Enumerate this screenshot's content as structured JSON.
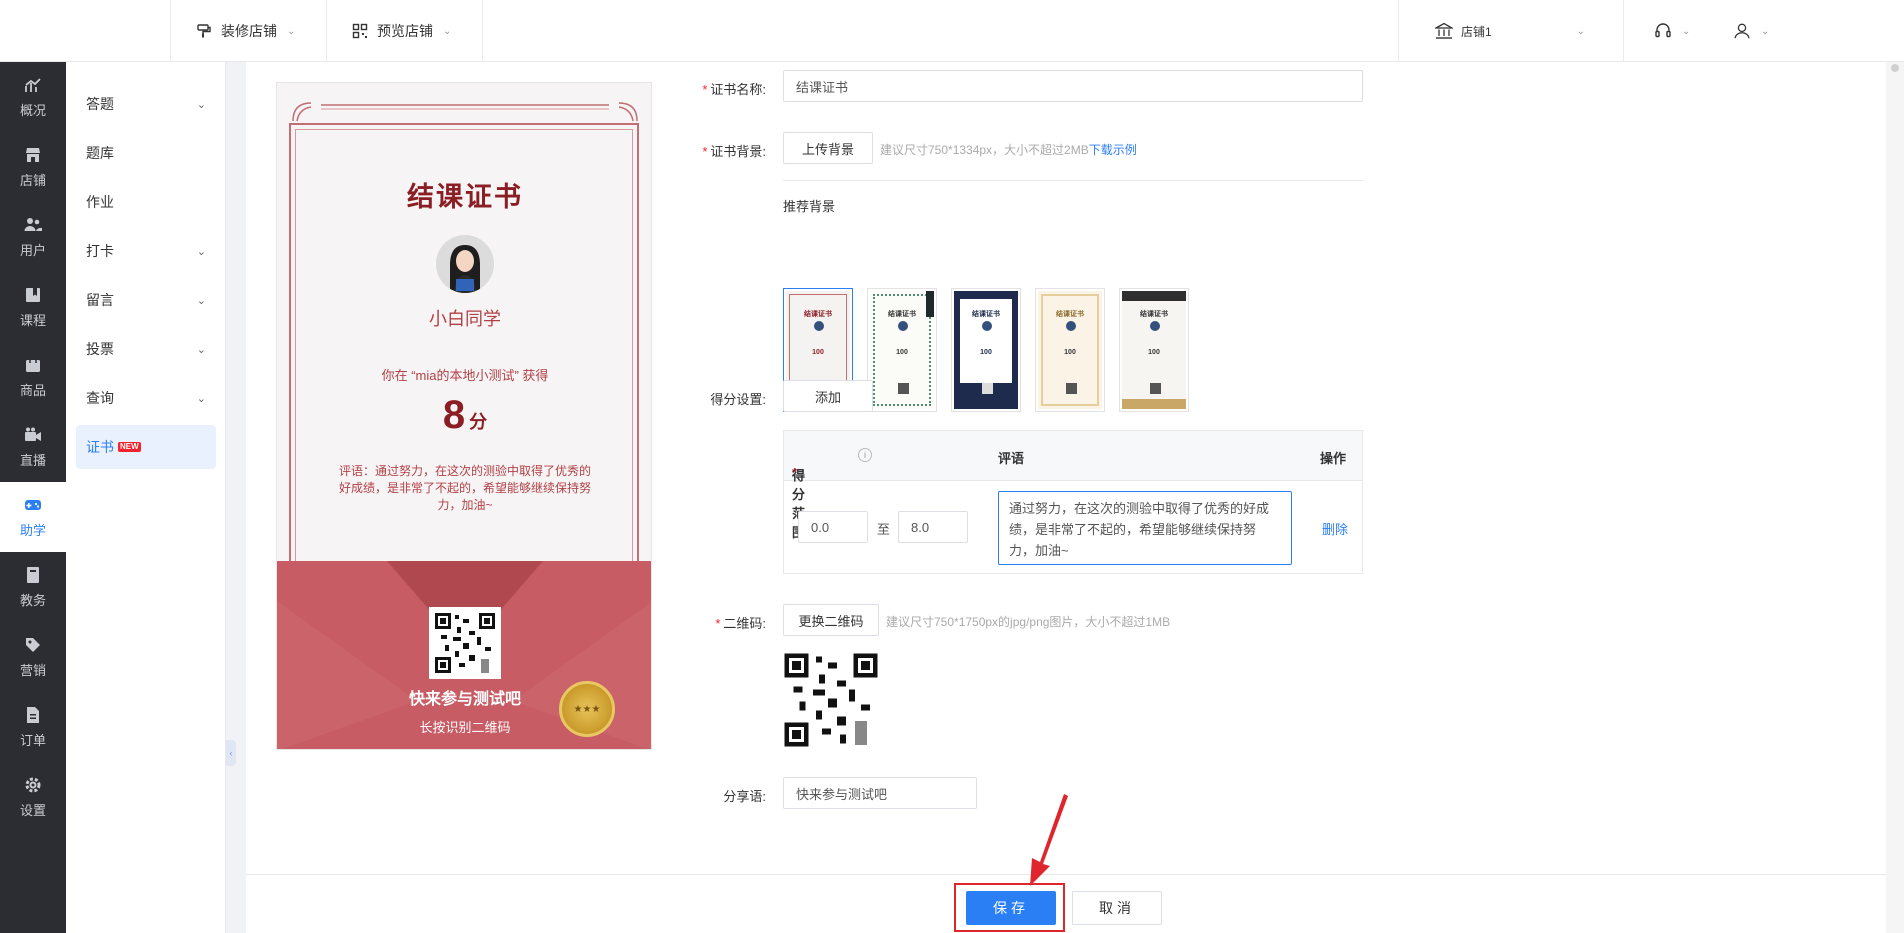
{
  "topbar": {
    "decorate_label": "装修店铺",
    "preview_label": "预览店铺",
    "shop_label": "店铺1"
  },
  "leftnav": [
    {
      "label": "概况",
      "icon": "chart-icon"
    },
    {
      "label": "店铺",
      "icon": "store-icon"
    },
    {
      "label": "用户",
      "icon": "users-icon"
    },
    {
      "label": "课程",
      "icon": "book-icon"
    },
    {
      "label": "商品",
      "icon": "bag-icon"
    },
    {
      "label": "直播",
      "icon": "video-icon"
    },
    {
      "label": "助学",
      "icon": "gamepad-icon"
    },
    {
      "label": "教务",
      "icon": "notebook-icon"
    },
    {
      "label": "营销",
      "icon": "tag-icon"
    },
    {
      "label": "订单",
      "icon": "document-icon"
    },
    {
      "label": "设置",
      "icon": "gear-icon"
    }
  ],
  "subnav": [
    {
      "label": "答题"
    },
    {
      "label": "题库"
    },
    {
      "label": "作业"
    },
    {
      "label": "打卡"
    },
    {
      "label": "留言"
    },
    {
      "label": "投票"
    },
    {
      "label": "查询"
    },
    {
      "label": "证书",
      "badge": "NEW"
    }
  ],
  "preview": {
    "title": "结课证书",
    "name": "小白同学",
    "line": "你在 “mia的本地小测试” 获得",
    "score": "8",
    "score_unit": "分",
    "comment": "评语：通过努力，在这次的测验中取得了优秀的好成绩，是非常了不起的，希望能够继续保持努力，加油~",
    "cta": "快来参与测试吧",
    "cta_sub": "长按识别二维码"
  },
  "form": {
    "name_label": "证书名称:",
    "name_value": "结课证书",
    "bg_label": "证书背景:",
    "upload_bg": "上传背景",
    "bg_hint": "建议尺寸750*1334px，大小不超过2MB",
    "download_example": "下载示例",
    "recommended_bg": "推荐背景",
    "thumbnails": [
      {
        "title": "结课证书",
        "num": "100",
        "style": "red"
      },
      {
        "title": "结课证书",
        "num": "100",
        "style": "green"
      },
      {
        "title": "结课证书",
        "num": "100",
        "style": "navy"
      },
      {
        "title": "结课证书",
        "num": "100",
        "style": "gold"
      },
      {
        "title": "结课证书",
        "num": "100",
        "style": "ink"
      }
    ],
    "score_label": "得分设置:",
    "add": "添加",
    "table": {
      "col_range": "得分范围",
      "col_comment": "评语",
      "col_action": "操作",
      "from": "0.0",
      "to_sep": "至",
      "to": "8.0",
      "comment": "通过努力，在这次的测验中取得了优秀的好成绩，是非常了不起的，希望能够继续保持努力，加油~",
      "delete": "删除"
    },
    "qr_label": "二维码:",
    "replace_qr": "更换二维码",
    "qr_hint": "建议尺寸750*1750px的jpg/png图片，大小不超过1MB",
    "share_label": "分享语:",
    "share_value": "快来参与测试吧"
  },
  "footer": {
    "save": "保存",
    "cancel": "取消"
  },
  "colors": {
    "primary": "#2b7ff5",
    "nav_dark": "#2b2d33",
    "cert_red": "#c75c64",
    "annotation_red": "#e0262d"
  }
}
